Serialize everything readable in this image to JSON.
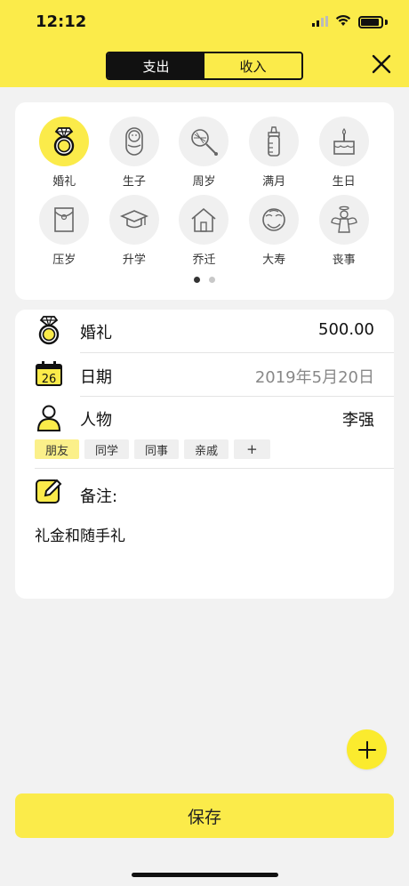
{
  "status": {
    "time": "12:12"
  },
  "segment": {
    "expense": "支出",
    "income": "收入"
  },
  "categories": [
    {
      "label": "婚礼",
      "icon": "ring-icon",
      "selected": true
    },
    {
      "label": "生子",
      "icon": "baby-icon"
    },
    {
      "label": "周岁",
      "icon": "rattle-icon"
    },
    {
      "label": "满月",
      "icon": "bottle-icon"
    },
    {
      "label": "生日",
      "icon": "cake-icon"
    },
    {
      "label": "压岁",
      "icon": "red-envelope-icon"
    },
    {
      "label": "升学",
      "icon": "graduation-cap-icon"
    },
    {
      "label": "乔迁",
      "icon": "house-icon"
    },
    {
      "label": "大寿",
      "icon": "elder-face-icon"
    },
    {
      "label": "丧事",
      "icon": "angel-icon"
    }
  ],
  "pager": {
    "pages": 2,
    "current": 1
  },
  "form": {
    "category": {
      "label": "婚礼",
      "amount": "500.00"
    },
    "date": {
      "label": "日期",
      "calendar_day": "26",
      "value": "2019年5月20日"
    },
    "person": {
      "label": "人物",
      "value": "李强"
    },
    "tags": [
      {
        "label": "朋友",
        "selected": true
      },
      {
        "label": "同学"
      },
      {
        "label": "同事"
      },
      {
        "label": "亲戚"
      }
    ],
    "add_tag": "+",
    "note": {
      "label": "备注:",
      "text": "礼金和随手礼"
    }
  },
  "save_label": "保存",
  "colors": {
    "accent": "#fbeb4a",
    "dark": "#111111"
  }
}
